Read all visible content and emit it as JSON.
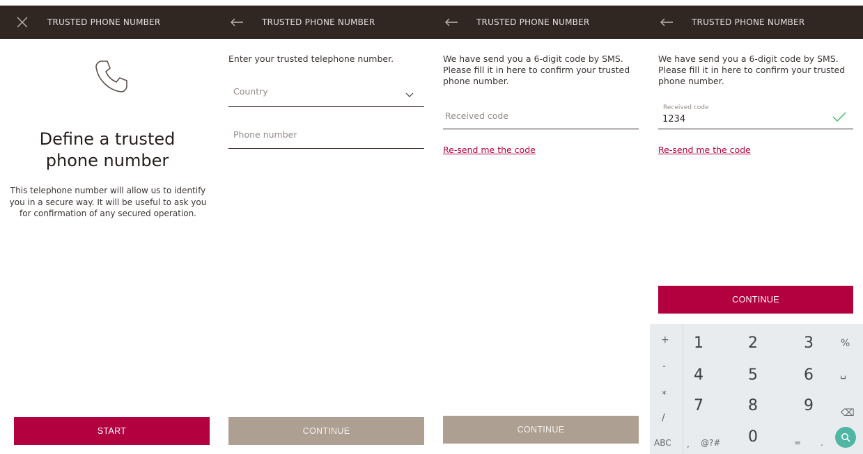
{
  "header_title": "TRUSTED PHONE NUMBER",
  "colors": {
    "brand": "#b3003e",
    "topbar": "#302622",
    "disabled_button": "#ae9f93",
    "success": "#3bb85c"
  },
  "screen1": {
    "nav_icon": "close-icon",
    "heading_line1": "Define a trusted",
    "heading_line2": "phone number",
    "description": "This telephone number will allow us to identify you in a secure way. It will be useful to ask you for confirmation of any secured operation.",
    "start_label": "START"
  },
  "screen2": {
    "nav_icon": "back-arrow-icon",
    "instruction": "Enter your trusted telephone number.",
    "country_placeholder": "Country",
    "phone_placeholder": "Phone number",
    "continue_label": "CONTINUE"
  },
  "screen3": {
    "nav_icon": "back-arrow-icon",
    "instruction": "We have send you a 6-digit code by SMS. Please fill it in here to confirm your trusted phone number.",
    "code_placeholder": "Received code",
    "resend_label": "Re-send me the code",
    "continue_label": "CONTINUE"
  },
  "screen4": {
    "nav_icon": "back-arrow-icon",
    "instruction": "We have send you a 6-digit code by SMS. Please fill it in here to confirm your trusted phone number.",
    "code_label": "Received code",
    "code_value": "1234",
    "resend_label": "Re-send me the code",
    "continue_label": "CONTINUE"
  },
  "keypad": {
    "left_keys": [
      "+",
      "-",
      "*",
      "/"
    ],
    "digits": [
      "1",
      "2",
      "3",
      "4",
      "5",
      "6",
      "7",
      "8",
      "9",
      "0"
    ],
    "right_keys": [
      "%",
      "␣",
      "⌫"
    ],
    "bottom_keys": [
      "ABC",
      ",",
      "@?#",
      "="
    ],
    "dot_key": ".",
    "search_icon": "search-icon"
  }
}
